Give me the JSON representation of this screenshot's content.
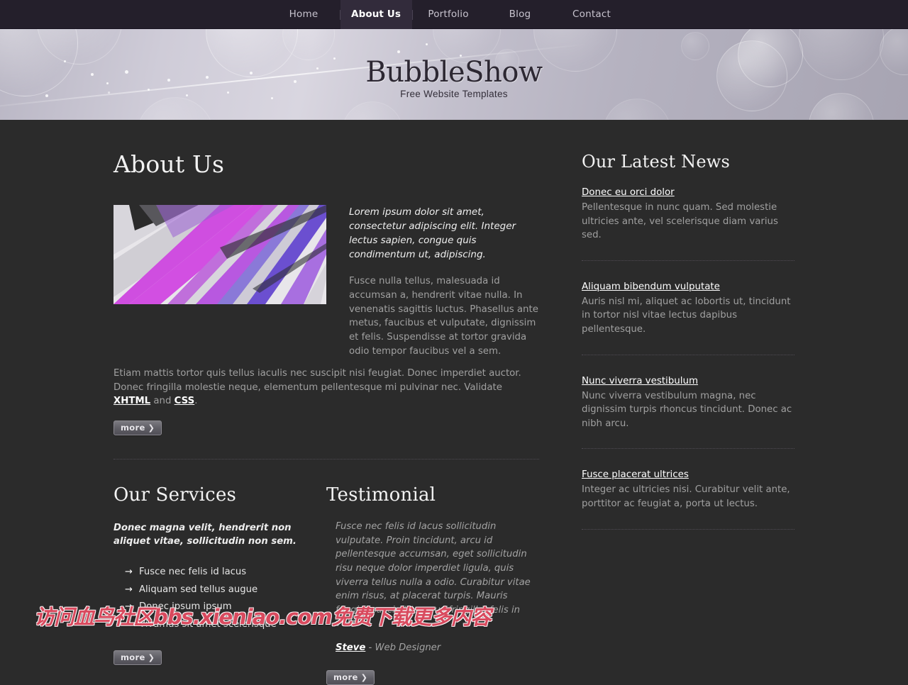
{
  "nav": {
    "items": [
      {
        "label": "Home",
        "active": false
      },
      {
        "label": "About Us",
        "active": true
      },
      {
        "label": "Portfolio",
        "active": false
      },
      {
        "label": "Blog",
        "active": false
      },
      {
        "label": "Contact",
        "active": false
      }
    ]
  },
  "banner": {
    "logo_title": "BubbleShow",
    "logo_subtitle": "Free Website Templates"
  },
  "about": {
    "heading": "About Us",
    "image_alt": "abstract-purple-stripes",
    "lead": "Lorem ipsum dolor sit amet, consectetur adipiscing elit. Integer lectus sapien, congue quis condimentum ut, adipiscing.",
    "paragraph": "Fusce nulla tellus, malesuada id accumsan a, hendrerit vitae nulla. In venenatis sagittis luctus. Phasellus ante metus, faucibus et vulputate, dignissim et felis. Suspendisse at tortor gravida odio tempor faucibus vel a sem.",
    "paragraph2_before": "Etiam mattis tortor quis tellus iaculis nec suscipit nisi feugiat. Donec imperdiet auctor. Donec fringilla molestie neque, elementum pellentesque mi pulvinar nec. Validate ",
    "link_xhtml": "XHTML",
    "paragraph2_mid": " and ",
    "link_css": "CSS",
    "paragraph2_end": ".",
    "more_label": "more",
    "more_arrow": "❯"
  },
  "services": {
    "heading": "Our Services",
    "lead": "Donec magna velit, hendrerit non aliquet vitae, sollicitudin non sem.",
    "bullet_icon": "→",
    "items": [
      "Fusce nec felis id lacus",
      "Aliquam sed tellus augue",
      "Donec ipsum ipsum",
      "Vivamus sit amet scelerisque"
    ],
    "more_label": "more",
    "more_arrow": "❯"
  },
  "testimonial": {
    "heading": "Testimonial",
    "quote": "Fusce nec felis id lacus sollicitudin vulputate. Proin tincidunt, arcu id pellentesque accumsan, eget sollicitudin risu neque dolor imperdiet ligula, quis viverra tellus nulla a odio. Curabitur vitae enim risus, at placerat turpis. Mauris feugiat suscipit tempus fringilla, felis in velit.",
    "author": "Steve",
    "author_role": " - Web Designer",
    "more_label": "more",
    "more_arrow": "❯"
  },
  "news": {
    "heading": "Our Latest News",
    "items": [
      {
        "title": "Donec eu orci dolor",
        "text": "Pellentesque in nunc quam. Sed molestie ultricies ante, vel scelerisque diam varius sed."
      },
      {
        "title": "Aliquam bibendum vulputate",
        "text": "Auris nisl mi, aliquet ac lobortis ut, tincidunt in tortor nisl vitae lectus dapibus pellentesque."
      },
      {
        "title": "Nunc viverra vestibulum",
        "text": "Nunc viverra vestibulum magna, nec dignissim turpis rhoncus tincidunt. Donec ac nibh arcu."
      },
      {
        "title": "Fusce placerat ultrices",
        "text": "Integer ac ultricies nisi. Curabitur velit ante, porttitor ac feugiat a, porta ut lectus."
      }
    ]
  },
  "watermark": {
    "text": "访问血鸟社区bbs.xieniao.com免费下载更多内容",
    "color": "#d94a5e"
  },
  "colors": {
    "page_bg": "#2b2b2b",
    "nav_bg": "#241f2b",
    "nav_active_bg": "#322b3b",
    "text_body": "#a0a0a0",
    "text_bright": "#ffffff"
  }
}
